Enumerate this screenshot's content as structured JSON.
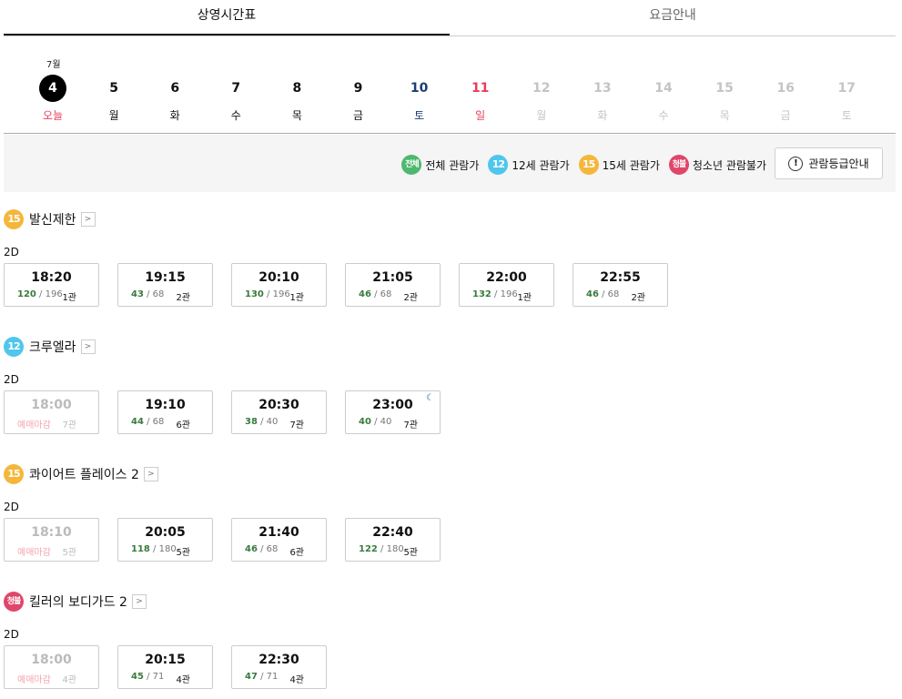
{
  "tabs": [
    "상영시간표",
    "요금안내"
  ],
  "month_label": "7월",
  "dates": [
    {
      "num": "4",
      "dow": "오늘",
      "type": "today"
    },
    {
      "num": "5",
      "dow": "월",
      "type": "normal"
    },
    {
      "num": "6",
      "dow": "화",
      "type": "normal"
    },
    {
      "num": "7",
      "dow": "수",
      "type": "normal"
    },
    {
      "num": "8",
      "dow": "목",
      "type": "normal"
    },
    {
      "num": "9",
      "dow": "금",
      "type": "normal"
    },
    {
      "num": "10",
      "dow": "토",
      "type": "sat"
    },
    {
      "num": "11",
      "dow": "일",
      "type": "sun"
    },
    {
      "num": "12",
      "dow": "월",
      "type": "disabled"
    },
    {
      "num": "13",
      "dow": "화",
      "type": "disabled"
    },
    {
      "num": "14",
      "dow": "수",
      "type": "disabled"
    },
    {
      "num": "15",
      "dow": "목",
      "type": "disabled"
    },
    {
      "num": "16",
      "dow": "금",
      "type": "disabled"
    },
    {
      "num": "17",
      "dow": "토",
      "type": "disabled"
    }
  ],
  "legend": [
    {
      "badge": "전체",
      "cls": "b-all",
      "label": "전체 관람가"
    },
    {
      "badge": "12",
      "cls": "b-12",
      "label": "12세 관람가"
    },
    {
      "badge": "15",
      "cls": "b-15",
      "label": "15세 관람가"
    },
    {
      "badge": "청불",
      "cls": "b-18",
      "label": "청소년 관람불가"
    }
  ],
  "rating_guide_button": "관람등급안내",
  "info_icon_glyph": "!",
  "arrow_glyph": ">",
  "movies": [
    {
      "badge": "15",
      "cls": "b-15",
      "title": "발신제한",
      "format": "2D",
      "showtimes": [
        {
          "time": "18:20",
          "avail": "120",
          "total": "196",
          "hall": "1관",
          "closed": false
        },
        {
          "time": "19:15",
          "avail": "43",
          "total": "68",
          "hall": "2관",
          "closed": false
        },
        {
          "time": "20:10",
          "avail": "130",
          "total": "196",
          "hall": "1관",
          "closed": false
        },
        {
          "time": "21:05",
          "avail": "46",
          "total": "68",
          "hall": "2관",
          "closed": false
        },
        {
          "time": "22:00",
          "avail": "132",
          "total": "196",
          "hall": "1관",
          "closed": false
        },
        {
          "time": "22:55",
          "avail": "46",
          "total": "68",
          "hall": "2관",
          "closed": false
        }
      ]
    },
    {
      "badge": "12",
      "cls": "b-12",
      "title": "크루엘라",
      "format": "2D",
      "showtimes": [
        {
          "time": "18:00",
          "status": "예매마감",
          "hall": "7관",
          "closed": true
        },
        {
          "time": "19:10",
          "avail": "44",
          "total": "68",
          "hall": "6관",
          "closed": false
        },
        {
          "time": "20:30",
          "avail": "38",
          "total": "40",
          "hall": "7관",
          "closed": false
        },
        {
          "time": "23:00",
          "avail": "40",
          "total": "40",
          "hall": "7관",
          "closed": false,
          "night": true
        }
      ]
    },
    {
      "badge": "15",
      "cls": "b-15",
      "title": "콰이어트 플레이스 2",
      "format": "2D",
      "showtimes": [
        {
          "time": "18:10",
          "status": "예매마감",
          "hall": "5관",
          "closed": true
        },
        {
          "time": "20:05",
          "avail": "118",
          "total": "180",
          "hall": "5관",
          "closed": false
        },
        {
          "time": "21:40",
          "avail": "46",
          "total": "68",
          "hall": "6관",
          "closed": false
        },
        {
          "time": "22:40",
          "avail": "122",
          "total": "180",
          "hall": "5관",
          "closed": false
        }
      ]
    },
    {
      "badge": "청불",
      "cls": "b-18",
      "title": "킬러의 보디가드 2",
      "format": "2D",
      "showtimes": [
        {
          "time": "18:00",
          "status": "예매마감",
          "hall": "4관",
          "closed": true
        },
        {
          "time": "20:15",
          "avail": "45",
          "total": "71",
          "hall": "4관",
          "closed": false
        },
        {
          "time": "22:30",
          "avail": "47",
          "total": "71",
          "hall": "4관",
          "closed": false
        }
      ]
    }
  ]
}
